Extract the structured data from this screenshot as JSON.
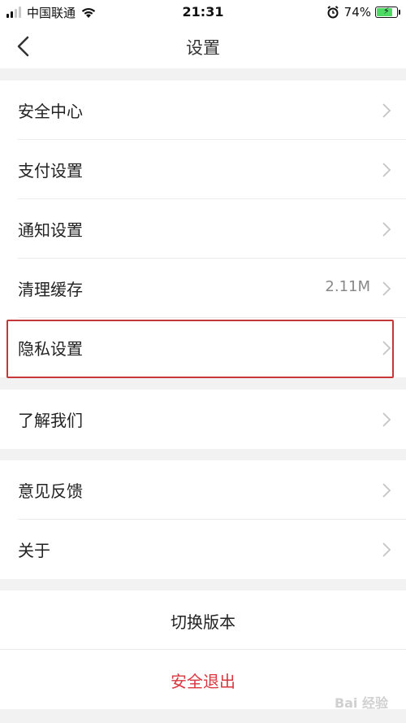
{
  "status_bar": {
    "carrier": "中国联通",
    "time": "21:31",
    "battery_percent": "74%",
    "battery_level": 0.74,
    "icons": [
      "signal-icon",
      "wifi-icon",
      "alarm-icon",
      "battery-icon",
      "charging-icon"
    ]
  },
  "header": {
    "title": "设置",
    "back_icon": "chevron-left-icon"
  },
  "groups": [
    {
      "items": [
        {
          "label": "安全中心"
        },
        {
          "label": "支付设置"
        },
        {
          "label": "通知设置"
        },
        {
          "label": "清理缓存",
          "value": "2.11M"
        },
        {
          "label": "隐私设置",
          "highlighted": true
        }
      ]
    },
    {
      "items": [
        {
          "label": "了解我们"
        }
      ]
    },
    {
      "items": [
        {
          "label": "意见反馈"
        },
        {
          "label": "关于"
        }
      ]
    }
  ],
  "actions": {
    "switch_version": "切换版本",
    "logout": "安全退出"
  },
  "colors": {
    "background": "#f2f2f2",
    "logout_text": "#d9363e",
    "highlight_border": "#c6373a",
    "battery_fill": "#4cd964"
  },
  "watermark": "Bai 经验"
}
